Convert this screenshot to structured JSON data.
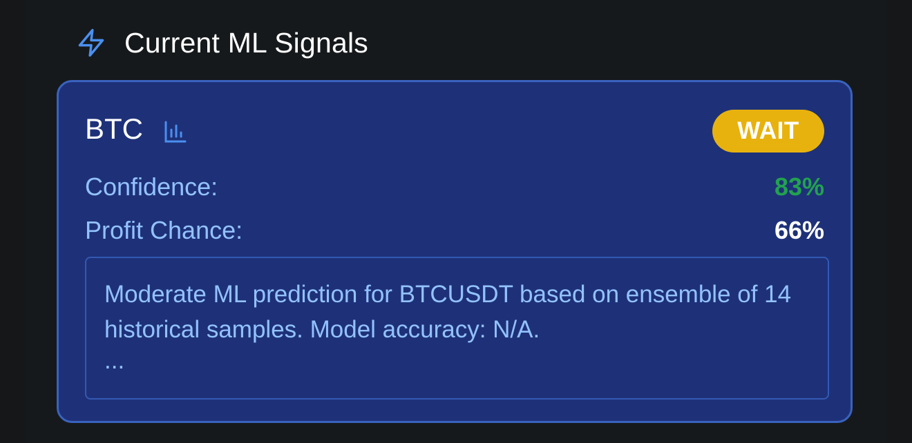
{
  "section": {
    "title": "Current ML Signals",
    "icon": "lightning-bolt-icon",
    "icon_color": "#4a90f0"
  },
  "signal": {
    "symbol": "BTC",
    "chart_icon": "bar-chart-icon",
    "action": "WAIT",
    "action_color": "#e8b20e",
    "confidence_label": "Confidence:",
    "confidence_value": "83%",
    "confidence_color": "#22a24f",
    "profit_label": "Profit Chance:",
    "profit_value": "66%",
    "description": "Moderate ML prediction for BTCUSDT based on ensemble of 14 historical samples. Model accuracy: N/A.",
    "description_more": "..."
  }
}
